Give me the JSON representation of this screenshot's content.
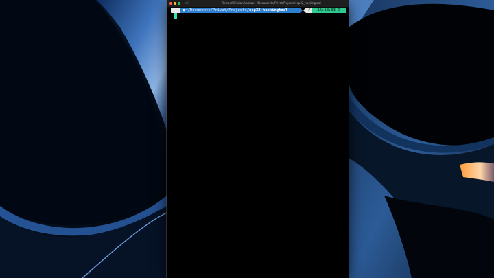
{
  "window": {
    "title": "ReinardéFlorian-Laptop:~/Documents/Privat/Projects/esp32_hackingtool",
    "shortcut": "⌥⌘1"
  },
  "prompt": {
    "os_icon": "",
    "folder_icon": "■",
    "path_prefix": "~/Documents/Privat/Projects/",
    "path_leaf": "esp32_hackingtool",
    "status_icon": "✔",
    "time": "16:18:03 ⏱"
  },
  "colors": {
    "dir_segment": "#2f7fd1",
    "time_segment": "#2fc98f",
    "status_segment": "#e9e9e9",
    "cursor": "#3be3a8"
  },
  "icons": [
    "apple-icon",
    "folder-icon",
    "checkmark-icon",
    "clock-icon"
  ]
}
